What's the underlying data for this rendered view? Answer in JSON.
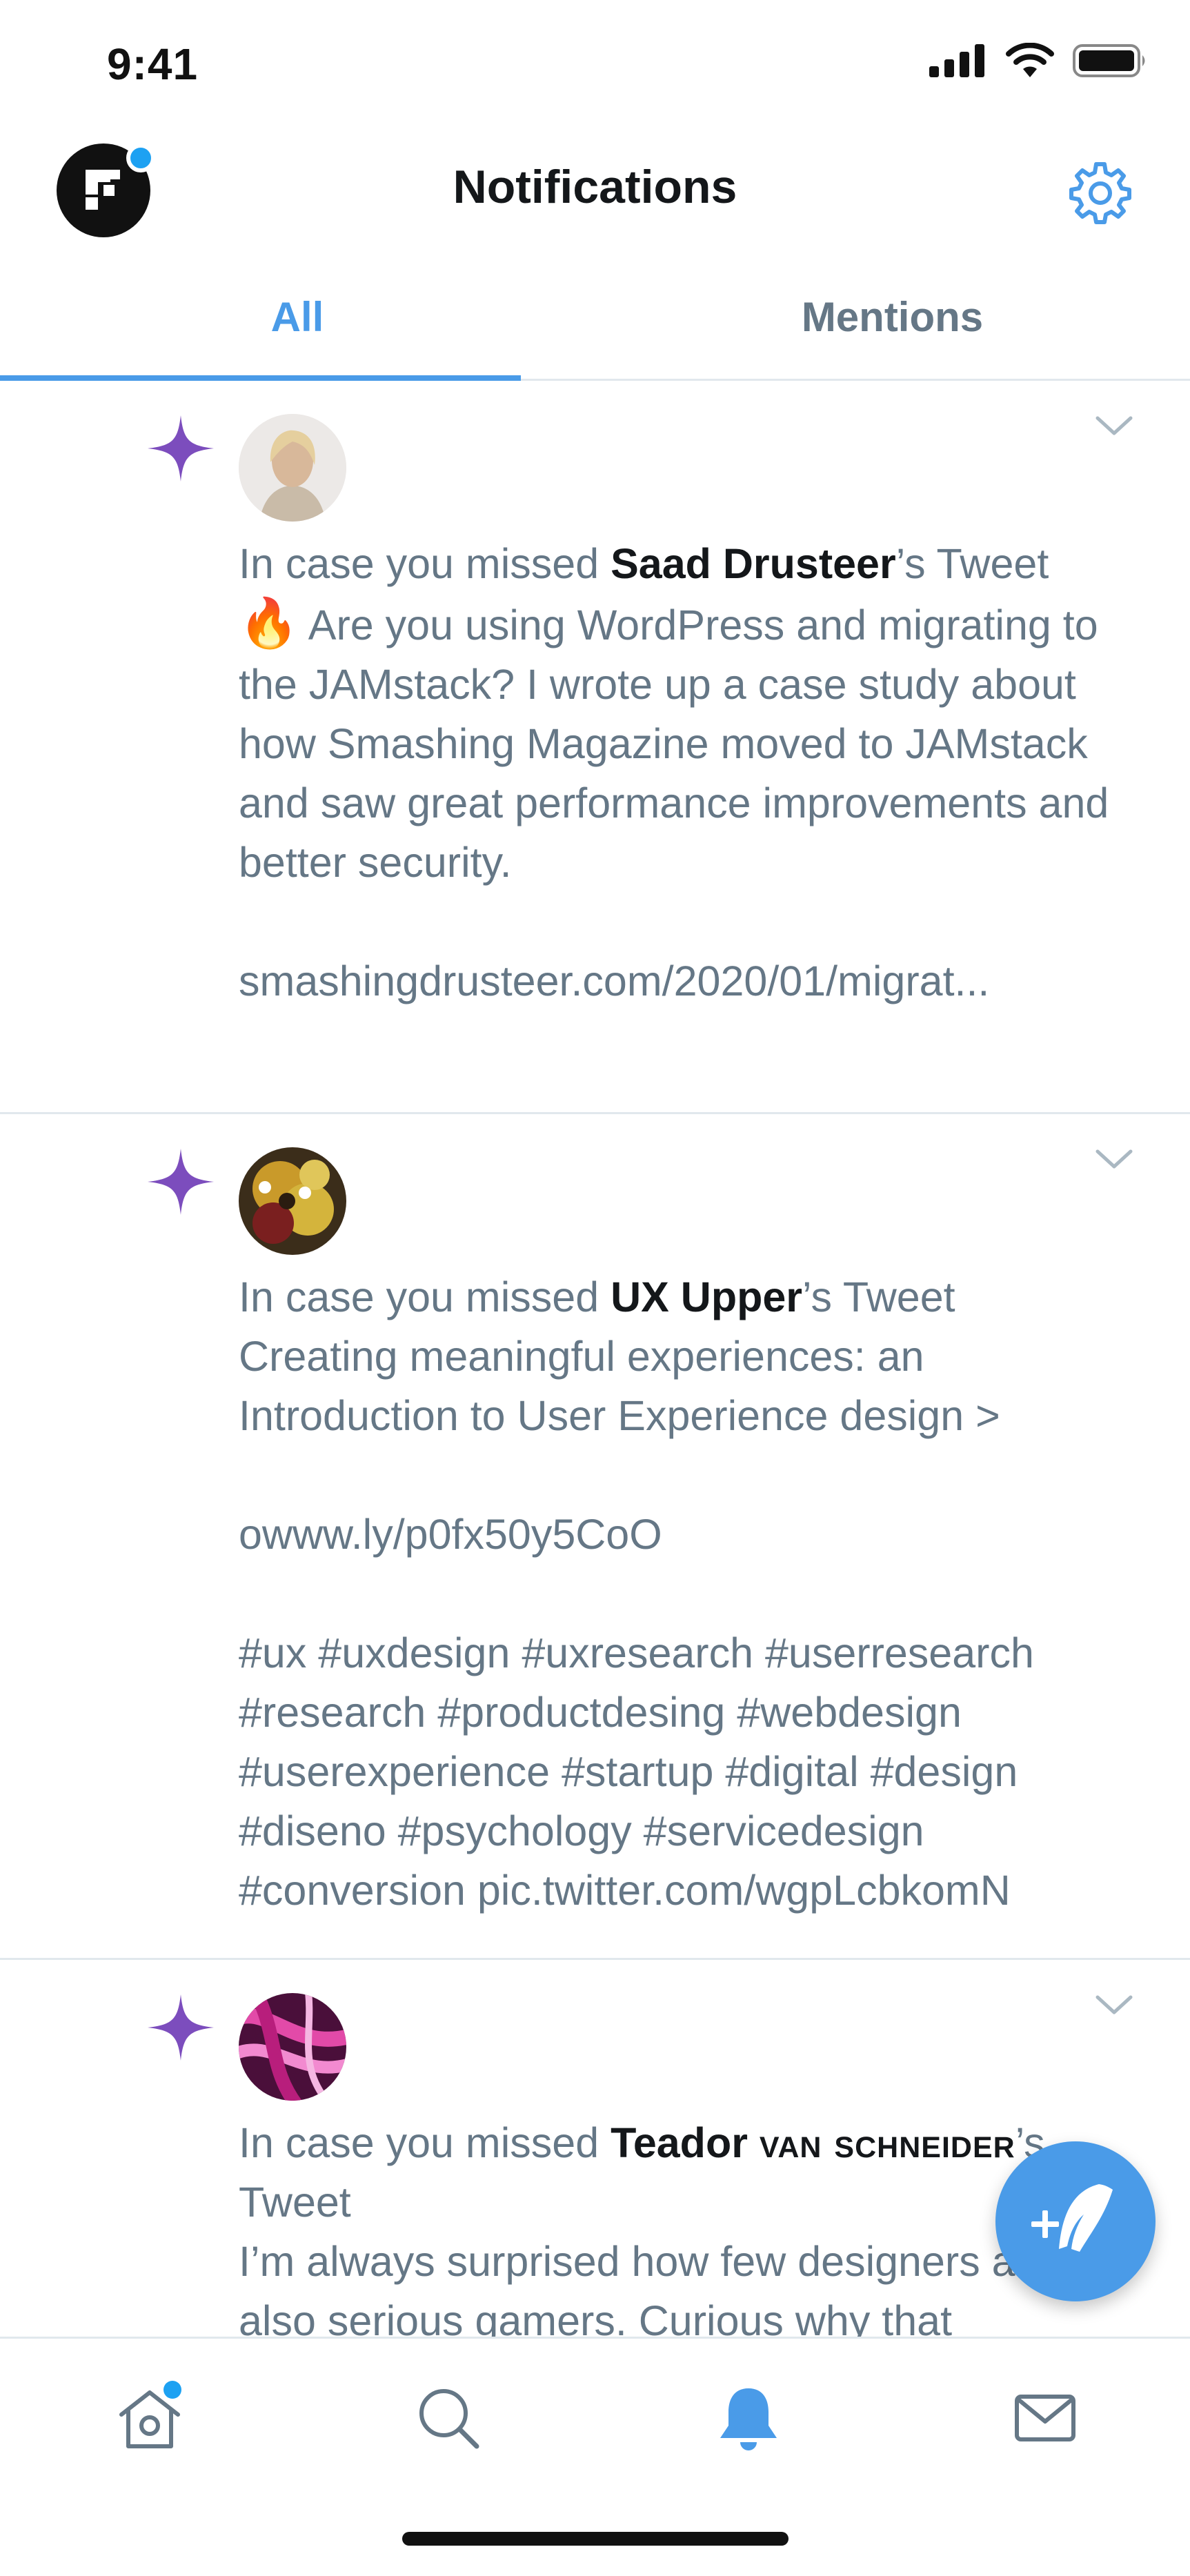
{
  "status_bar": {
    "time": "9:41",
    "icons": [
      "cellular-signal-icon",
      "wifi-icon",
      "battery-icon"
    ]
  },
  "header": {
    "title": "Notifications",
    "settings_icon": "gear-icon",
    "has_unread_dot": true
  },
  "tabs": [
    {
      "label": "All",
      "selected": true
    },
    {
      "label": "Mentions",
      "selected": false
    }
  ],
  "notifications": [
    {
      "prefix": "In case you missed ",
      "name": "Saad Drusteer",
      "suffix": "’s Tweet",
      "emoji": "🔥",
      "body": "Are you using WordPress and migrating to the JAMstack? I wrote up a case study about how Smashing Magazine moved to JAMstack and saw great performance improvements and better security.\n\nsmashingdrusteer.com/2020/01/migrat..."
    },
    {
      "prefix": "In case you missed ",
      "name": "UX Upper",
      "suffix": "’s Tweet",
      "body": "Creating meaningful experiences: an Introduction to User Experience design >\n\nowww.ly/p0fx50y5CoO\n\n#ux #uxdesign #uxresearch #userresearch #research #productdesing #webdesign #userexperience #startup #digital #design #diseno #psychology #servicedesign #conversion pic.twitter.com/wgpLcbkomN"
    },
    {
      "prefix": "In case you missed ",
      "name": "Teador ",
      "name_smallcaps": "van schneider",
      "suffix": "’s Tweet",
      "body": "I’m always surprised how few designers are also serious gamers. Curious why that"
    }
  ],
  "fab": {
    "icon": "compose-tweet-icon"
  },
  "tabbar": [
    {
      "icon": "home-icon",
      "active": false,
      "has_dot": true
    },
    {
      "icon": "search-icon",
      "active": false
    },
    {
      "icon": "bell-icon",
      "active": true
    },
    {
      "icon": "mail-icon",
      "active": false
    }
  ],
  "colors": {
    "accent": "#4a9be8",
    "sparkle": "#7c4dbd",
    "secondary_text": "#657786",
    "primary_text": "#14171a",
    "divider": "#e1e8ed"
  }
}
